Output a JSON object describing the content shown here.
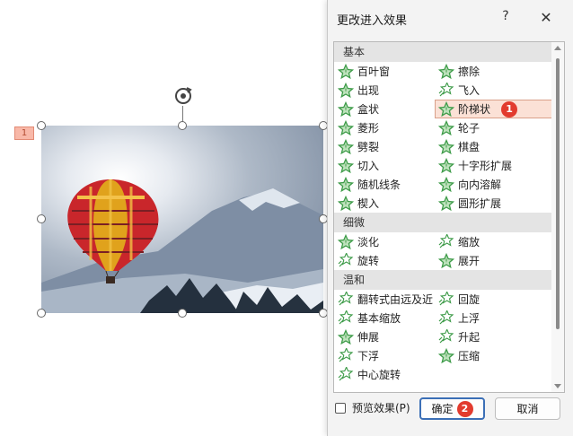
{
  "slide": {
    "animation_order": "1"
  },
  "dialog": {
    "title": "更改进入效果",
    "help": "?",
    "close": "✕",
    "groups": [
      {
        "name": "基本",
        "items": [
          {
            "label": "百叶窗",
            "icon": "star-effect-icon"
          },
          {
            "label": "擦除",
            "icon": "star-effect-icon"
          },
          {
            "label": "出现",
            "icon": "star-effect-icon"
          },
          {
            "label": "飞入",
            "icon": "star-motion-icon"
          },
          {
            "label": "盒状",
            "icon": "star-effect-icon"
          },
          {
            "label": "阶梯状",
            "icon": "star-effect-icon",
            "selected": true,
            "badge": "1"
          },
          {
            "label": "菱形",
            "icon": "star-effect-icon"
          },
          {
            "label": "轮子",
            "icon": "star-effect-icon"
          },
          {
            "label": "劈裂",
            "icon": "star-effect-icon"
          },
          {
            "label": "棋盘",
            "icon": "star-effect-icon"
          },
          {
            "label": "切入",
            "icon": "star-effect-icon"
          },
          {
            "label": "十字形扩展",
            "icon": "star-effect-icon"
          },
          {
            "label": "随机线条",
            "icon": "star-effect-icon"
          },
          {
            "label": "向内溶解",
            "icon": "star-effect-icon"
          },
          {
            "label": "楔入",
            "icon": "star-effect-icon"
          },
          {
            "label": "圆形扩展",
            "icon": "star-effect-icon"
          }
        ]
      },
      {
        "name": "细微",
        "items": [
          {
            "label": "淡化",
            "icon": "star-effect-icon"
          },
          {
            "label": "缩放",
            "icon": "star-motion-icon"
          },
          {
            "label": "旋转",
            "icon": "star-motion-icon"
          },
          {
            "label": "展开",
            "icon": "star-effect-icon"
          }
        ]
      },
      {
        "name": "温和",
        "items": [
          {
            "label": "翻转式由远及近",
            "icon": "star-motion-icon"
          },
          {
            "label": "回旋",
            "icon": "star-motion-icon"
          },
          {
            "label": "基本缩放",
            "icon": "star-motion-icon"
          },
          {
            "label": "上浮",
            "icon": "star-motion-icon"
          },
          {
            "label": "伸展",
            "icon": "star-effect-icon"
          },
          {
            "label": "升起",
            "icon": "star-motion-icon"
          },
          {
            "label": "下浮",
            "icon": "star-motion-icon"
          },
          {
            "label": "压缩",
            "icon": "star-effect-icon"
          },
          {
            "label": "中心旋转",
            "icon": "star-motion-icon"
          }
        ]
      }
    ],
    "preview_label": "预览效果(P)",
    "preview_checked": false,
    "ok_label": "确定",
    "ok_badge": "2",
    "cancel_label": "取消"
  },
  "colors": {
    "star_green": "#3d9b48",
    "badge_red": "#e23b2e",
    "selected_bg": "#fbe1d6",
    "ok_border": "#3b6fb6"
  }
}
